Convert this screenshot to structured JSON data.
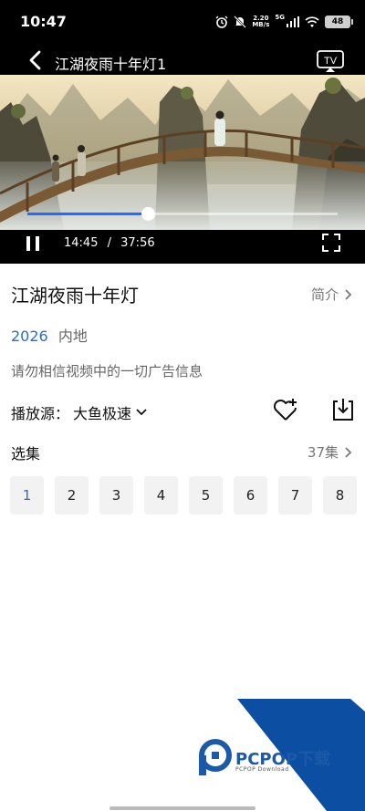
{
  "status_bar": {
    "time": "10:47",
    "net_speed_value": "2.20",
    "net_speed_unit": "MB/s",
    "signal_label": "5G",
    "battery": "48"
  },
  "player": {
    "title": "江湖夜雨十年灯1",
    "current_time": "14:45",
    "separator": "/",
    "total_time": "37:56",
    "progress_fraction": 0.389,
    "accent_color": "#1e6fff",
    "cast_label": "TV"
  },
  "show": {
    "title": "江湖夜雨十年灯",
    "intro_label": "简介",
    "year": "2026",
    "region": "内地",
    "notice": "请勿相信视频中的一切广告信息",
    "source_prefix": "播放源：",
    "source_name": "大鱼极速"
  },
  "episodes": {
    "label": "选集",
    "count": "37集",
    "items": [
      "1",
      "2",
      "3",
      "4",
      "5",
      "6",
      "7",
      "8"
    ],
    "active_index": 0
  },
  "watermark": {
    "brand": "PCPOP下载",
    "sub": "PCPOP Download",
    "color": "#1b5aa8"
  }
}
